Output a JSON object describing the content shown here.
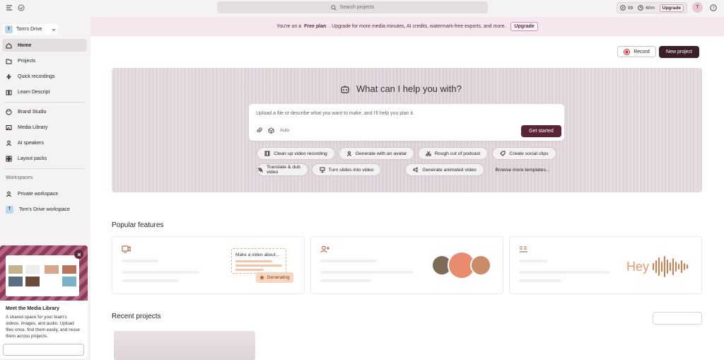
{
  "topbar": {
    "search_placeholder": "Search projects",
    "credits_a": "99",
    "credits_b": "60m",
    "upgrade": "Upgrade",
    "avatar_initial": "T"
  },
  "sidebar": {
    "drive": "Tom's Drive",
    "drive_initial": "T",
    "items": [
      {
        "label": "Home",
        "icon": "home-icon"
      },
      {
        "label": "Projects",
        "icon": "folder-icon"
      },
      {
        "label": "Quick recordings",
        "icon": "bolt-icon"
      },
      {
        "label": "Learn Descript",
        "icon": "book-icon"
      },
      {
        "label": "Brand Studio",
        "icon": "palette-icon"
      },
      {
        "label": "Media Library",
        "icon": "media-icon"
      },
      {
        "label": "AI speakers",
        "icon": "ai-speakers-icon"
      },
      {
        "label": "Layout packs",
        "icon": "grid-icon"
      }
    ],
    "workspaces_header": "Workspaces",
    "workspaces": [
      {
        "label": "Private workspace",
        "icon": "user-icon"
      },
      {
        "label": "Tom's Drive workspace",
        "initial": "T"
      }
    ],
    "promo": {
      "title": "Meet the Media Library",
      "body": "A shared space for your team's videos, images, and audio. Upload files once, find them easily, and reuse them across projects."
    }
  },
  "banner": {
    "prefix": "You're on a",
    "plan": "Free plan",
    "suffix": ". Upgrade for more media minutes, AI credits, watermark-free exports, and more.",
    "upgrade": "Upgrade"
  },
  "actions": {
    "record": "Record",
    "new_project": "New project"
  },
  "hero": {
    "title": "What can I help you with?",
    "placeholder": "Upload a file or describe what you want to make, and I'll help you plan it.",
    "auto": "Auto",
    "get_started": "Get started",
    "chips_row1": [
      "Clean up video recording",
      "Generate with an avatar",
      "Rough cut of podcast",
      "Create social clips"
    ],
    "chips_row2": [
      "Translate & dub video",
      "Turn slides into video",
      "Generate animated video",
      "Browse more templates..."
    ]
  },
  "popular": {
    "heading": "Popular features",
    "card1": {
      "preview_text": "Make a video about...",
      "badge": "Generating"
    }
  },
  "recent": {
    "heading": "Recent projects"
  },
  "colors": {
    "accent": "#5a2336",
    "banner_bg": "#f5e7ed",
    "sidebar_bg": "#f4f2f3"
  }
}
